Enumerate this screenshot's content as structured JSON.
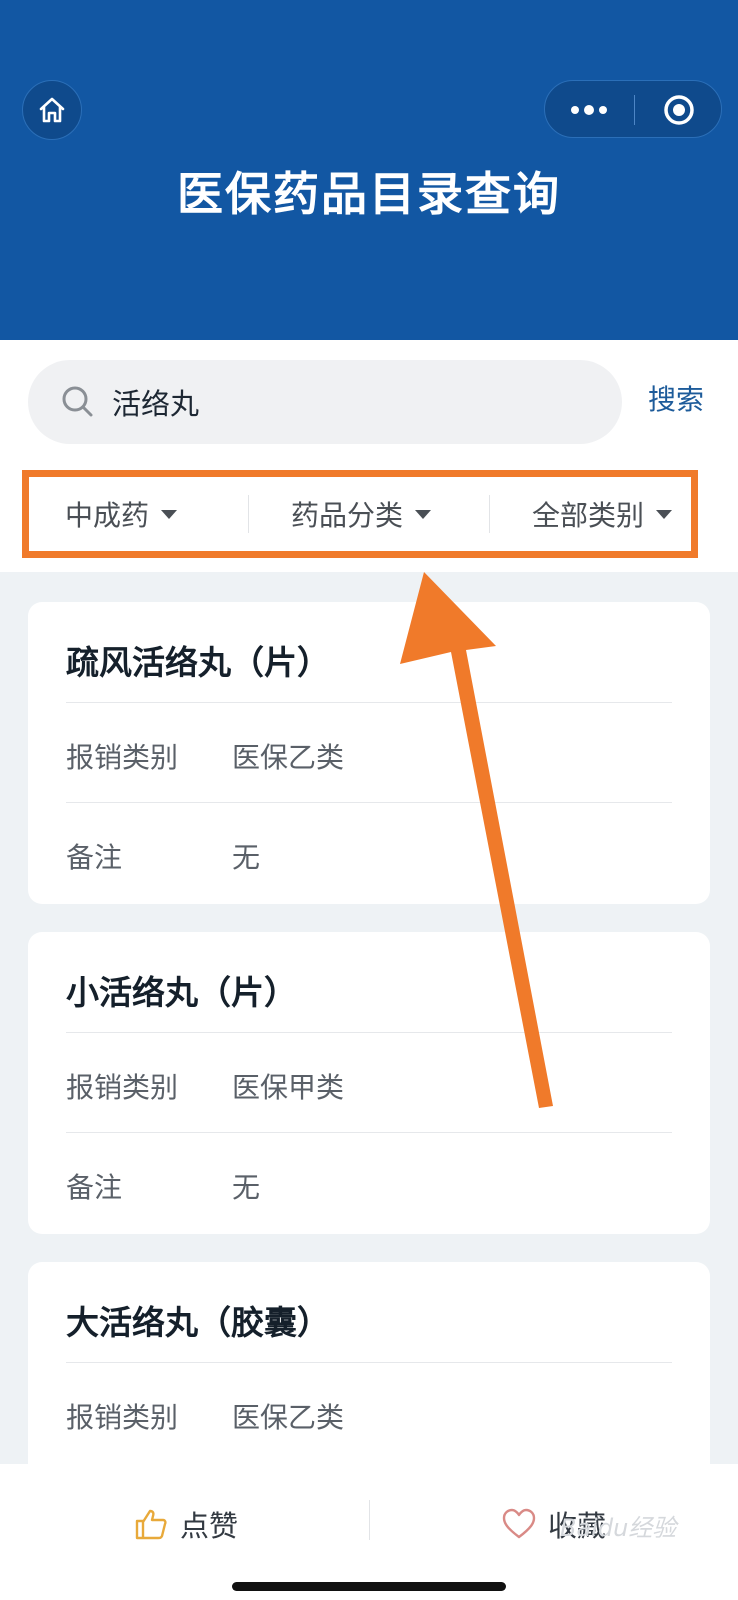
{
  "header": {
    "title": "医保药品目录查询",
    "bg_color": "#1257a3",
    "home_icon": "home-icon",
    "more_icon": "more-dots-icon",
    "close_icon": "target-circle-icon"
  },
  "search": {
    "value": "活络丸",
    "placeholder": "",
    "button_label": "搜索"
  },
  "filters": [
    {
      "label": "中成药"
    },
    {
      "label": "药品分类"
    },
    {
      "label": "全部类别"
    }
  ],
  "results": [
    {
      "name": "疏风活络丸（片）",
      "rows": [
        {
          "label": "报销类别",
          "value": "医保乙类"
        },
        {
          "label": "备注",
          "value": "无"
        }
      ]
    },
    {
      "name": "小活络丸（片）",
      "rows": [
        {
          "label": "报销类别",
          "value": "医保甲类"
        },
        {
          "label": "备注",
          "value": "无"
        }
      ]
    },
    {
      "name": "大活络丸（胶囊）",
      "rows": [
        {
          "label": "报销类别",
          "value": "医保乙类"
        }
      ]
    }
  ],
  "bottom_bar": {
    "like_label": "点赞",
    "favorite_label": "收藏"
  },
  "watermark": "Baidu经验",
  "annotation_color": "#f07a2a"
}
